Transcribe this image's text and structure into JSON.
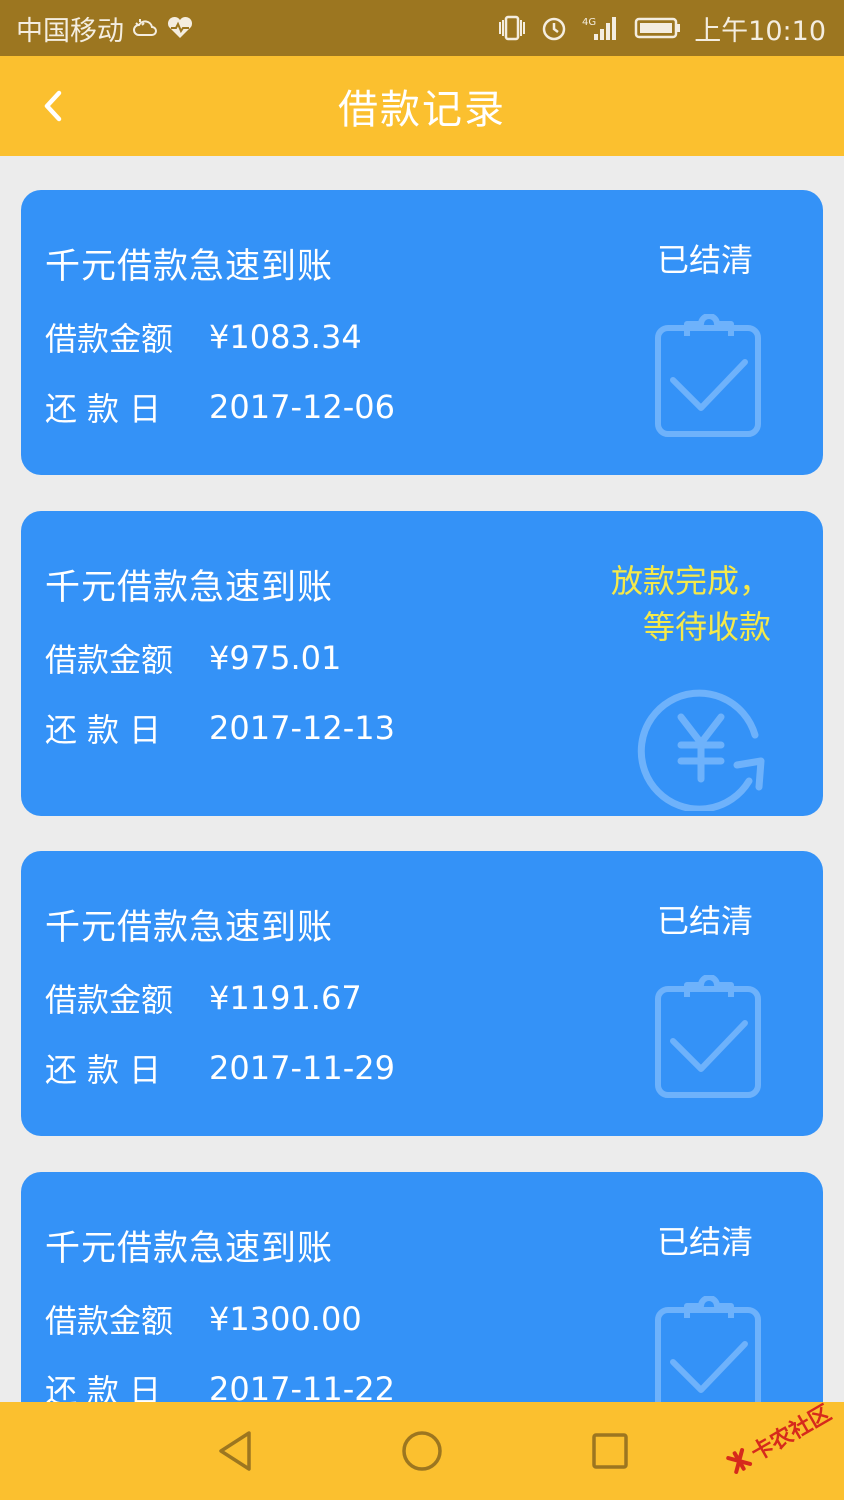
{
  "status_bar": {
    "carrier": "中国移动",
    "network": "4G",
    "time": "上午10:10"
  },
  "header": {
    "title": "借款记录"
  },
  "loans": [
    {
      "product": "千元借款急速到账",
      "amount_label": "借款金额",
      "amount": "¥1083.34",
      "due_label": "还款日",
      "due_date": "2017-12-06",
      "status_lines": [
        "已结清"
      ],
      "status_icon": "clipboard-check-icon"
    },
    {
      "product": "千元借款急速到账",
      "amount_label": "借款金额",
      "amount": "¥975.01",
      "due_label": "还款日",
      "due_date": "2017-12-13",
      "status_lines": [
        "放款完成，",
        "等待收款"
      ],
      "status_icon": "yuan-refresh-icon"
    },
    {
      "product": "千元借款急速到账",
      "amount_label": "借款金额",
      "amount": "¥1191.67",
      "due_label": "还款日",
      "due_date": "2017-11-29",
      "status_lines": [
        "已结清"
      ],
      "status_icon": "clipboard-check-icon"
    },
    {
      "product": "千元借款急速到账",
      "amount_label": "借款金额",
      "amount": "¥1300.00",
      "due_label": "还款日",
      "due_date": "2017-11-22",
      "status_lines": [
        "已结清"
      ],
      "status_icon": "clipboard-check-icon"
    }
  ],
  "watermark": {
    "text": "卡农社区"
  },
  "colors": {
    "app_bar": "#fbc02f",
    "status_bar": "#9c7620",
    "card": "#3492f7",
    "pending_status": "#f5e94a",
    "background": "#ececec"
  }
}
